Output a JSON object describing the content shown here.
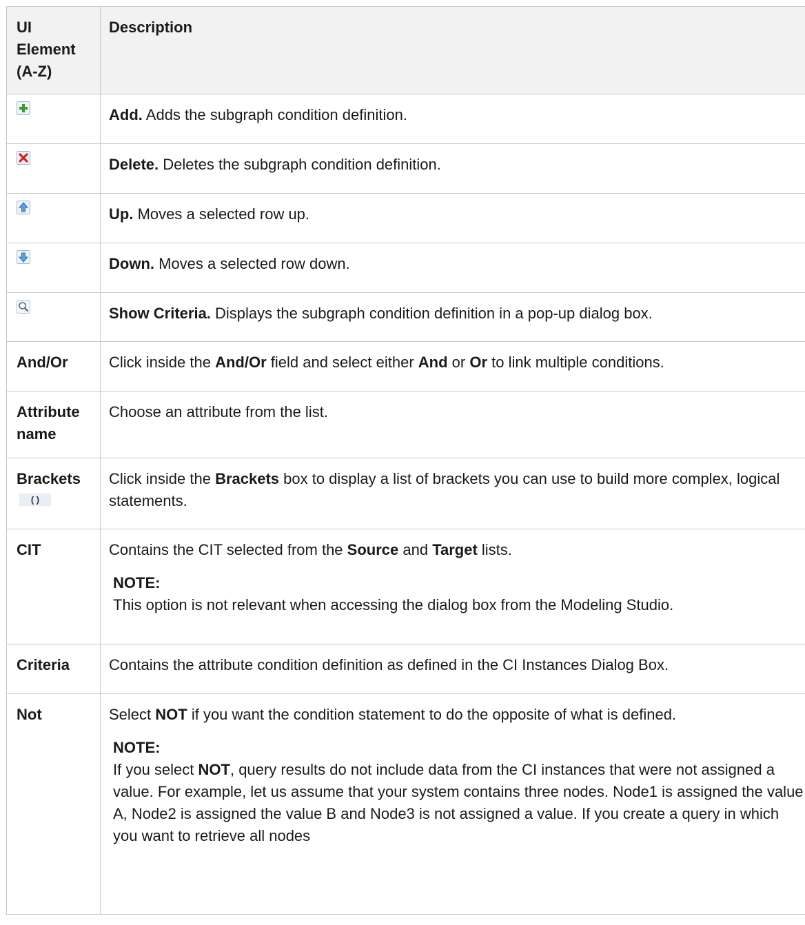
{
  "table": {
    "header": {
      "col1": "UI Element (A-Z)",
      "col2": "Description"
    },
    "rows": [
      {
        "icon": "add-icon",
        "term": "Add.",
        "text": " Adds the subgraph condition definition."
      },
      {
        "icon": "delete-icon",
        "term": "Delete.",
        "text": " Deletes the subgraph condition definition."
      },
      {
        "icon": "up-icon",
        "term": "Up.",
        "text": " Moves a selected row up."
      },
      {
        "icon": "down-icon",
        "term": "Down.",
        "text": " Moves a selected row down."
      },
      {
        "icon": "show-criteria-icon",
        "term": "Show Criteria.",
        "text": " Displays the subgraph condition definition in a pop-up dialog box."
      }
    ],
    "andor": {
      "name": "And/Or",
      "t1": "Click inside the ",
      "b1": "And/Or",
      "t2": " field and select either ",
      "b2": "And",
      "t3": " or ",
      "b3": "Or",
      "t4": " to link multiple conditions."
    },
    "attribute": {
      "name": "Attribute name",
      "text": "Choose an attribute from the list."
    },
    "brackets": {
      "name": "Brackets",
      "icon_text": "( )",
      "t1": "Click inside the ",
      "b1": "Brackets",
      "t2": " box to display a list of brackets you can use to build more complex, logical statements."
    },
    "cit": {
      "name": "CIT",
      "t1": "Contains the CIT selected from the ",
      "b1": "Source",
      "t2": " and ",
      "b2": "Target",
      "t3": " lists.",
      "note_label": "NOTE:",
      "note_text": "This option is not relevant when accessing the dialog box from the Modeling Studio."
    },
    "criteria": {
      "name": "Criteria",
      "text": "Contains the attribute condition definition as defined in the CI Instances Dialog Box."
    },
    "not": {
      "name": "Not",
      "t1": "Select ",
      "b1": "NOT",
      "t2": " if you want the condition statement to do the opposite of what is defined.",
      "note_label": "NOTE:",
      "n1": "If you select ",
      "nb1": "NOT",
      "n2": ", query results do not include data from the CI instances that were not assigned a value. For example, let us assume that your system contains three nodes. Node1 is assigned the value A, Node2 is assigned the value B and Node3 is not assigned a value. If you create a query in which you want to retrieve all nodes"
    }
  }
}
